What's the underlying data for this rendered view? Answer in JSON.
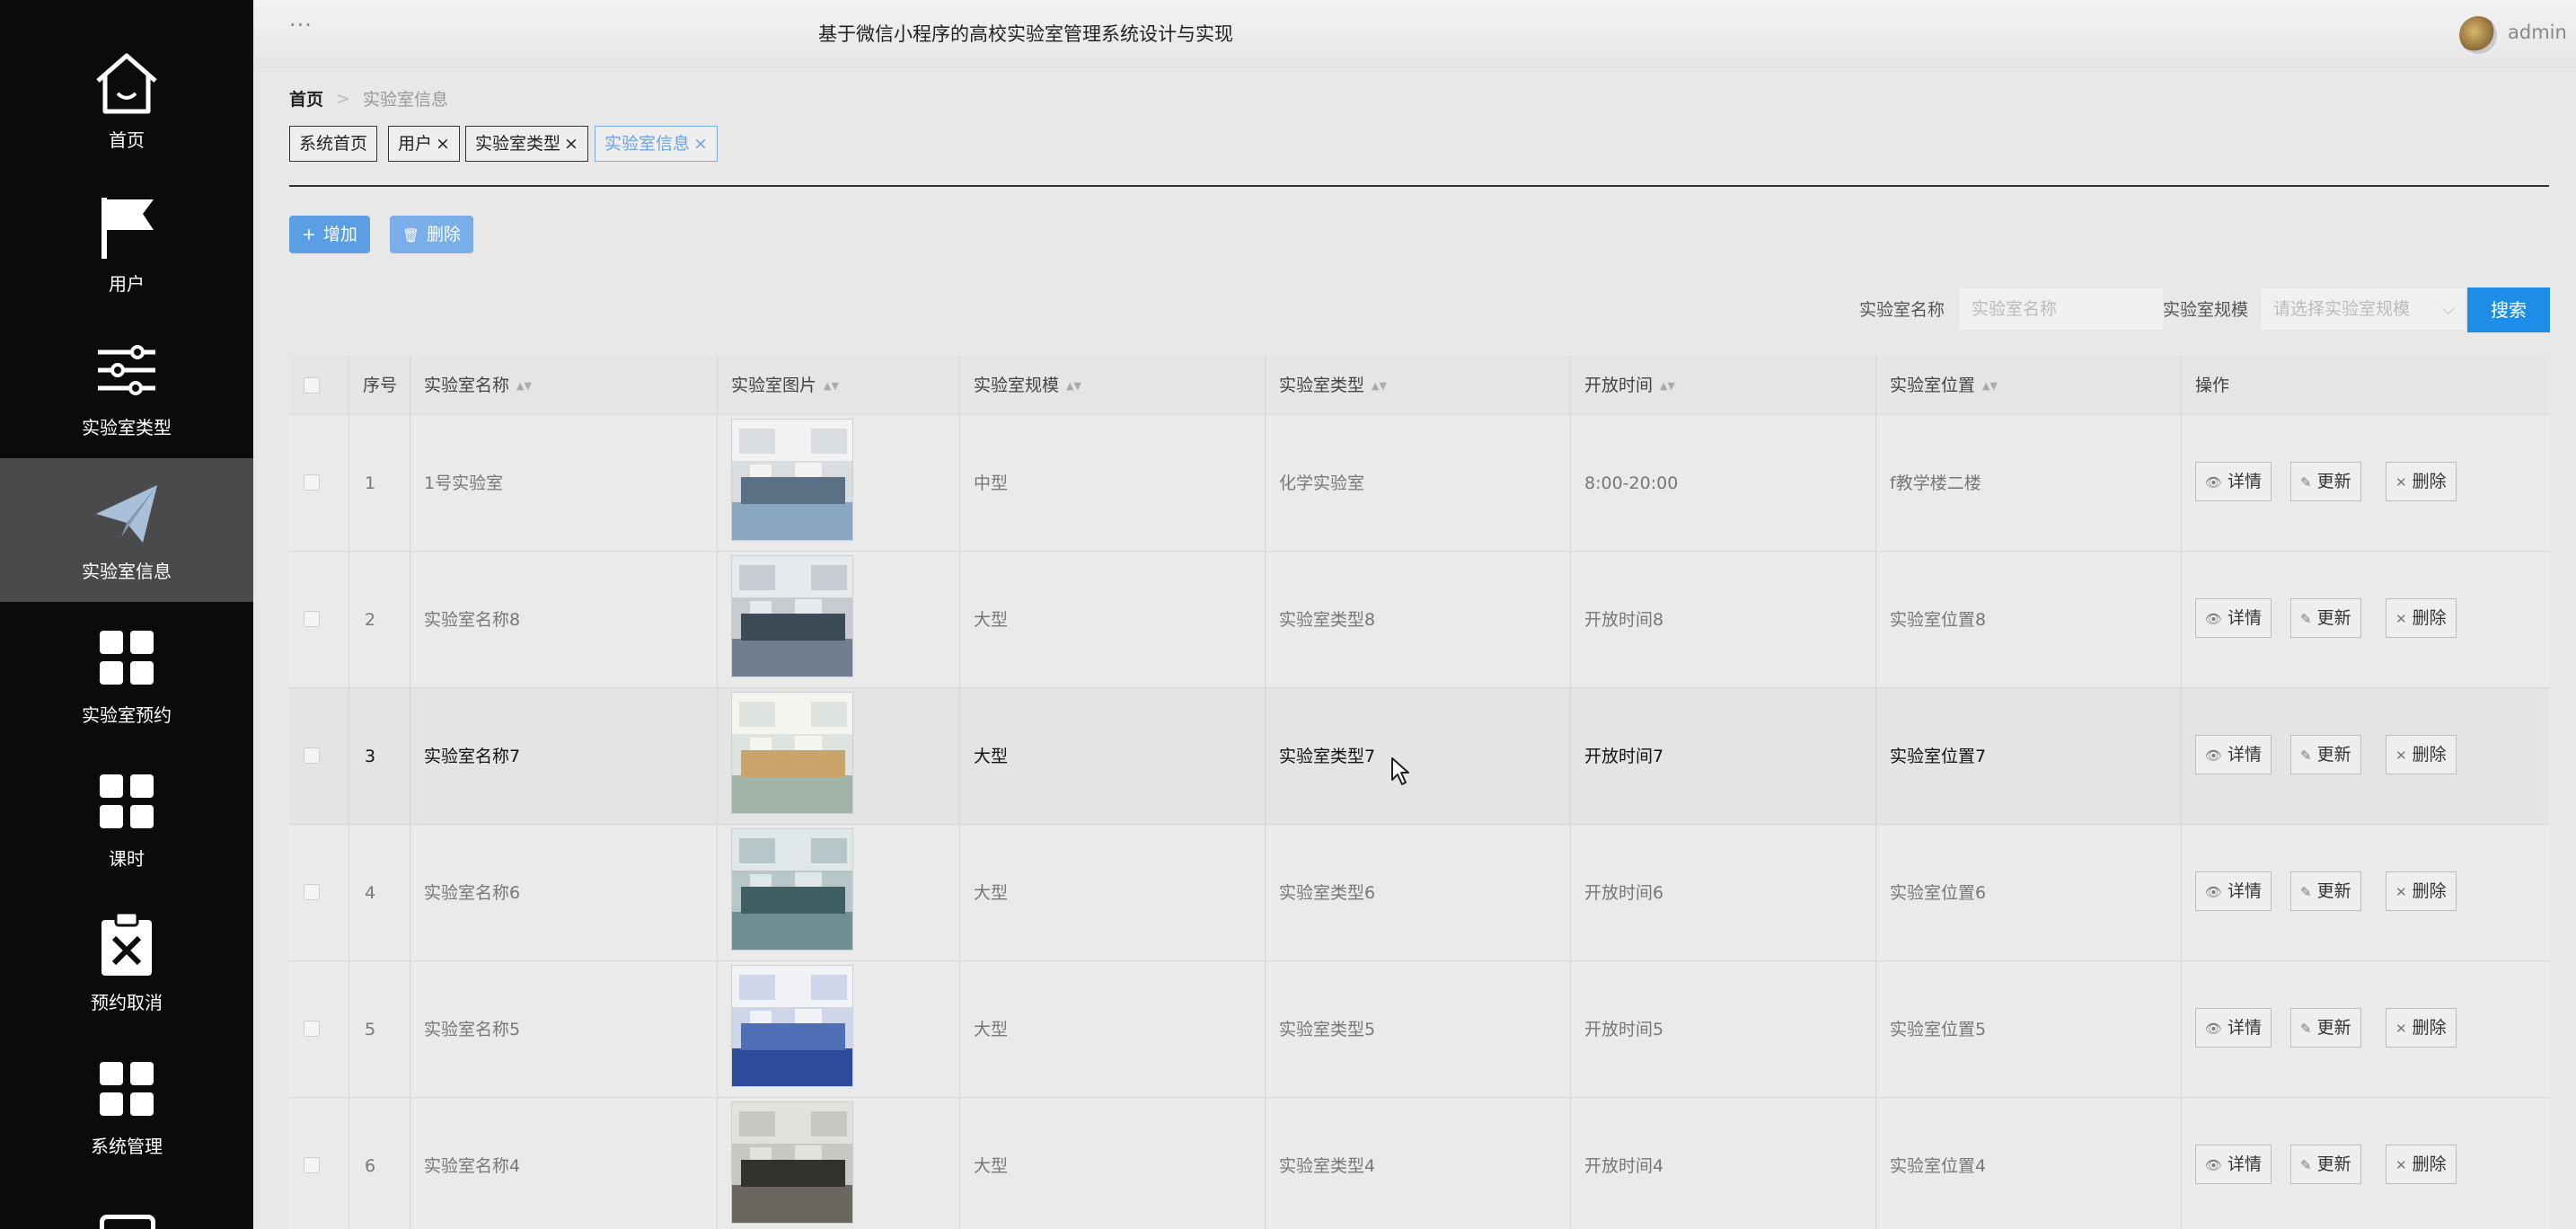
{
  "header": {
    "menu_dots": "···",
    "title": "基于微信小程序的高校实验室管理系统设计与实现",
    "user": "admin"
  },
  "sidebar": {
    "items": [
      {
        "label": "首页",
        "icon": "home-icon"
      },
      {
        "label": "用户",
        "icon": "flag-icon"
      },
      {
        "label": "实验室类型",
        "icon": "sliders-icon"
      },
      {
        "label": "实验室信息",
        "icon": "paper-plane-icon",
        "active": true
      },
      {
        "label": "实验室预约",
        "icon": "grid-icon"
      },
      {
        "label": "课时",
        "icon": "grid-icon"
      },
      {
        "label": "预约取消",
        "icon": "clipboard-x-icon"
      },
      {
        "label": "系统管理",
        "icon": "grid-icon"
      }
    ]
  },
  "breadcrumb": {
    "home": "首页",
    "sep": ">",
    "current": "实验室信息"
  },
  "tags": [
    {
      "label": "系统首页",
      "closable": false
    },
    {
      "label": "用户",
      "closable": true
    },
    {
      "label": "实验室类型",
      "closable": true
    },
    {
      "label": "实验室信息",
      "closable": true,
      "active": true
    }
  ],
  "tag_close": "×",
  "actions": {
    "add": "增加",
    "delete": "删除",
    "add_icon": "+",
    "delete_icon": "🗑"
  },
  "search": {
    "name_label": "实验室名称",
    "name_placeholder": "实验室名称",
    "scale_label": "实验室规模",
    "scale_placeholder": "请选择实验室规模",
    "button": "搜索"
  },
  "table": {
    "columns": [
      "序号",
      "实验室名称",
      "实验室图片",
      "实验室规模",
      "实验室类型",
      "开放时间",
      "实验室位置",
      "操作"
    ],
    "rows": [
      {
        "no": "1",
        "name": "1号实验室",
        "scale": "中型",
        "type": "化学实验室",
        "time": "8:00-20:00",
        "location": "f教学楼二楼"
      },
      {
        "no": "2",
        "name": "实验室名称8",
        "scale": "大型",
        "type": "实验室类型8",
        "time": "开放时间8",
        "location": "实验室位置8"
      },
      {
        "no": "3",
        "name": "实验室名称7",
        "scale": "大型",
        "type": "实验室类型7",
        "time": "开放时间7",
        "location": "实验室位置7"
      },
      {
        "no": "4",
        "name": "实验室名称6",
        "scale": "大型",
        "type": "实验室类型6",
        "time": "开放时间6",
        "location": "实验室位置6"
      },
      {
        "no": "5",
        "name": "实验室名称5",
        "scale": "大型",
        "type": "实验室类型5",
        "time": "开放时间5",
        "location": "实验室位置5"
      },
      {
        "no": "6",
        "name": "实验室名称4",
        "scale": "大型",
        "type": "实验室类型4",
        "time": "开放时间4",
        "location": "实验室位置4"
      }
    ],
    "ops": {
      "detail": "详情",
      "update": "更新",
      "delete": "删除",
      "detail_icon": "👁",
      "update_icon": "✎",
      "delete_icon": "✕"
    }
  }
}
